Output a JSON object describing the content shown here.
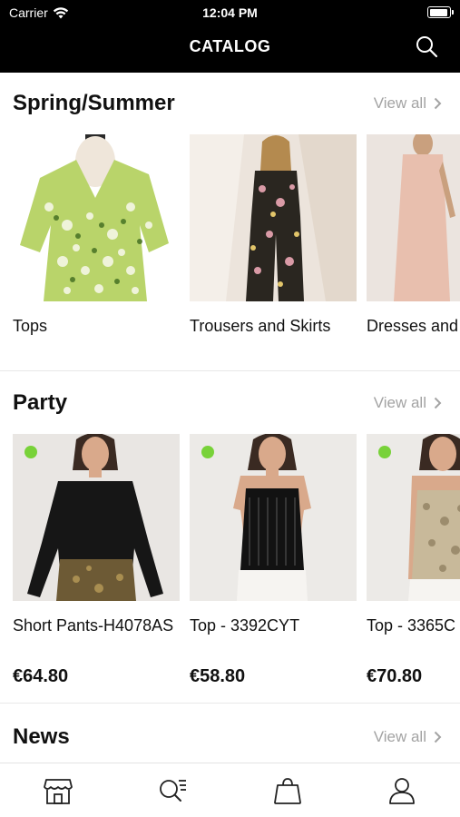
{
  "status": {
    "carrier": "Carrier",
    "time": "12:04 PM"
  },
  "nav": {
    "title": "CATALOG",
    "search_icon": "search-icon"
  },
  "sections": {
    "spring": {
      "title": "Spring/Summer",
      "view_all": "View all",
      "items": [
        {
          "name": "Tops"
        },
        {
          "name": "Trousers and Skirts"
        },
        {
          "name": "Dresses and Jumpsuits"
        }
      ]
    },
    "party": {
      "title": "Party",
      "view_all": "View all",
      "items": [
        {
          "name": "Short Pants-H4078AS",
          "price": "€64.80",
          "badge_color": "#78d239"
        },
        {
          "name": "Top - 3392CYT",
          "price": "€58.80",
          "badge_color": "#78d239"
        },
        {
          "name": "Top - 3365C",
          "price": "€70.80",
          "badge_color": "#78d239"
        }
      ]
    },
    "news": {
      "title": "News",
      "view_all": "View all"
    }
  },
  "tabbar": {
    "items": [
      {
        "icon": "store-icon"
      },
      {
        "icon": "search-list-icon"
      },
      {
        "icon": "shopping-bag-icon"
      },
      {
        "icon": "profile-icon"
      }
    ]
  },
  "colors": {
    "topbar": "#000000",
    "view_all": "#a3a3a3",
    "badge": "#78d239"
  }
}
